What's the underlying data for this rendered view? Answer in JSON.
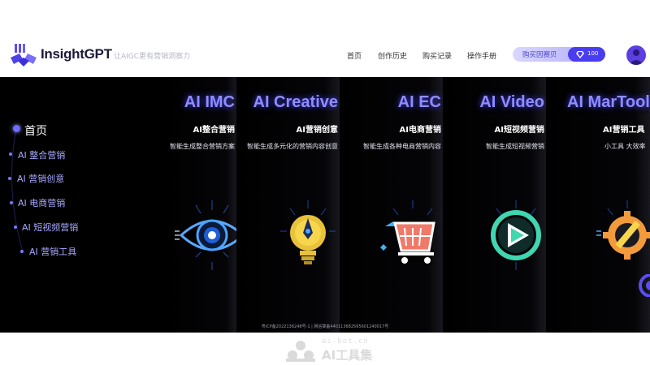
{
  "header": {
    "brand": "InsightGPT",
    "slogan": "让AIGC更有营销洞察力",
    "nav": [
      {
        "label": "首页"
      },
      {
        "label": "创作历史"
      },
      {
        "label": "购买记录"
      },
      {
        "label": "操作手册"
      }
    ],
    "buy_label": "购买因赛贝",
    "credits": "100"
  },
  "sidebar": {
    "items": [
      {
        "label": "首页"
      },
      {
        "label": "AI 整合营销"
      },
      {
        "label": "AI 营销创意"
      },
      {
        "label": "AI 电商营销"
      },
      {
        "label": "AI 短视频营销"
      },
      {
        "label": "AI 营销工具"
      }
    ]
  },
  "cards": [
    {
      "title": "AI IMC",
      "subtitle": "AI整合营销",
      "desc": "智能生成整合营销方案",
      "icon": "eye-icon",
      "color": "#4aa6ff"
    },
    {
      "title": "AI Creative",
      "subtitle": "AI营销创意",
      "desc": "智能生成多元化的营销内容创意",
      "icon": "lightbulb-icon",
      "color": "#e8c23a"
    },
    {
      "title": "AI EC",
      "subtitle": "AI电商营销",
      "desc": "智能生成各种电商营销内容",
      "icon": "shopping-cart-icon",
      "color": "#f07a6a"
    },
    {
      "title": "AI Video",
      "subtitle": "AI短视频营销",
      "desc": "智能生成短视频营销",
      "icon": "play-icon",
      "color": "#3fd6b0"
    },
    {
      "title": "AI MarTools",
      "subtitle": "AI营销工具",
      "desc": "小工具 大效率",
      "icon": "gear-pencil-icon",
      "color": "#f29a3c"
    }
  ],
  "footer": {
    "icp": "粤ICP备2022136248号-1  |  网信算备440113682565601240017号"
  },
  "watermark": {
    "url": "ai-bot.cn",
    "name": "AI工具集"
  }
}
